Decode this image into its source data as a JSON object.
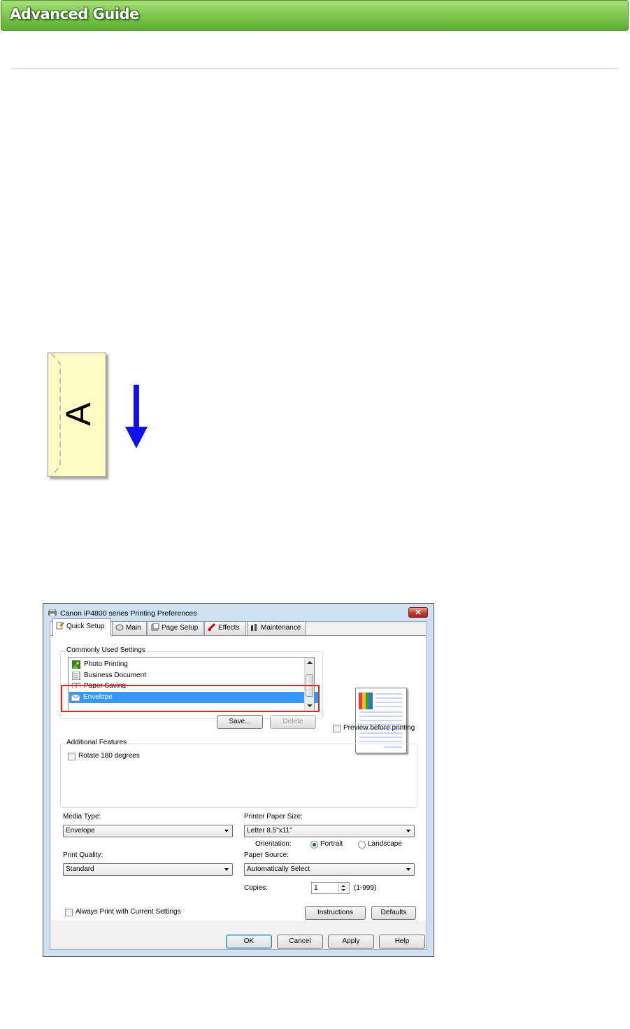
{
  "header": {
    "title": "Advanced Guide"
  },
  "illustration": {
    "envelope_letter": "A",
    "colors": {
      "envelope": "#fffbc5",
      "arrow": "#1111ee"
    }
  },
  "dialog": {
    "title": "Canon iP4800 series Printing Preferences",
    "close_label": "✕",
    "tabs": [
      {
        "label": "Quick Setup"
      },
      {
        "label": "Main"
      },
      {
        "label": "Page Setup"
      },
      {
        "label": "Effects"
      },
      {
        "label": "Maintenance"
      }
    ],
    "commonly_used_settings": {
      "label": "Commonly Used Settings",
      "items": [
        {
          "label": "Photo Printing"
        },
        {
          "label": "Business Document"
        },
        {
          "label": "Paper Saving"
        },
        {
          "label": "Envelope"
        }
      ],
      "selected": "Envelope",
      "save_label": "Save...",
      "delete_label": "Delete"
    },
    "preview_checkbox_label": "Preview before printing",
    "additional_features": {
      "label": "Additional Features",
      "rotate_label": "Rotate 180 degrees"
    },
    "media_type": {
      "label": "Media Type:",
      "value": "Envelope"
    },
    "printer_paper_size": {
      "label": "Printer Paper Size:",
      "value": "Letter 8.5\"x11\""
    },
    "orientation": {
      "label": "Orientation:",
      "portrait": "Portrait",
      "landscape": "Landscape",
      "selected": "Portrait"
    },
    "print_quality": {
      "label": "Print Quality:",
      "value": "Standard"
    },
    "paper_source": {
      "label": "Paper Source:",
      "value": "Automatically Select"
    },
    "copies": {
      "label": "Copies:",
      "value": "1",
      "range": "(1-999)"
    },
    "always_print_label": "Always Print with Current Settings",
    "instructions_label": "Instructions",
    "defaults_label": "Defaults",
    "ok_label": "OK",
    "cancel_label": "Cancel",
    "apply_label": "Apply",
    "help_label": "Help"
  },
  "highlight_color": "#e8211c"
}
